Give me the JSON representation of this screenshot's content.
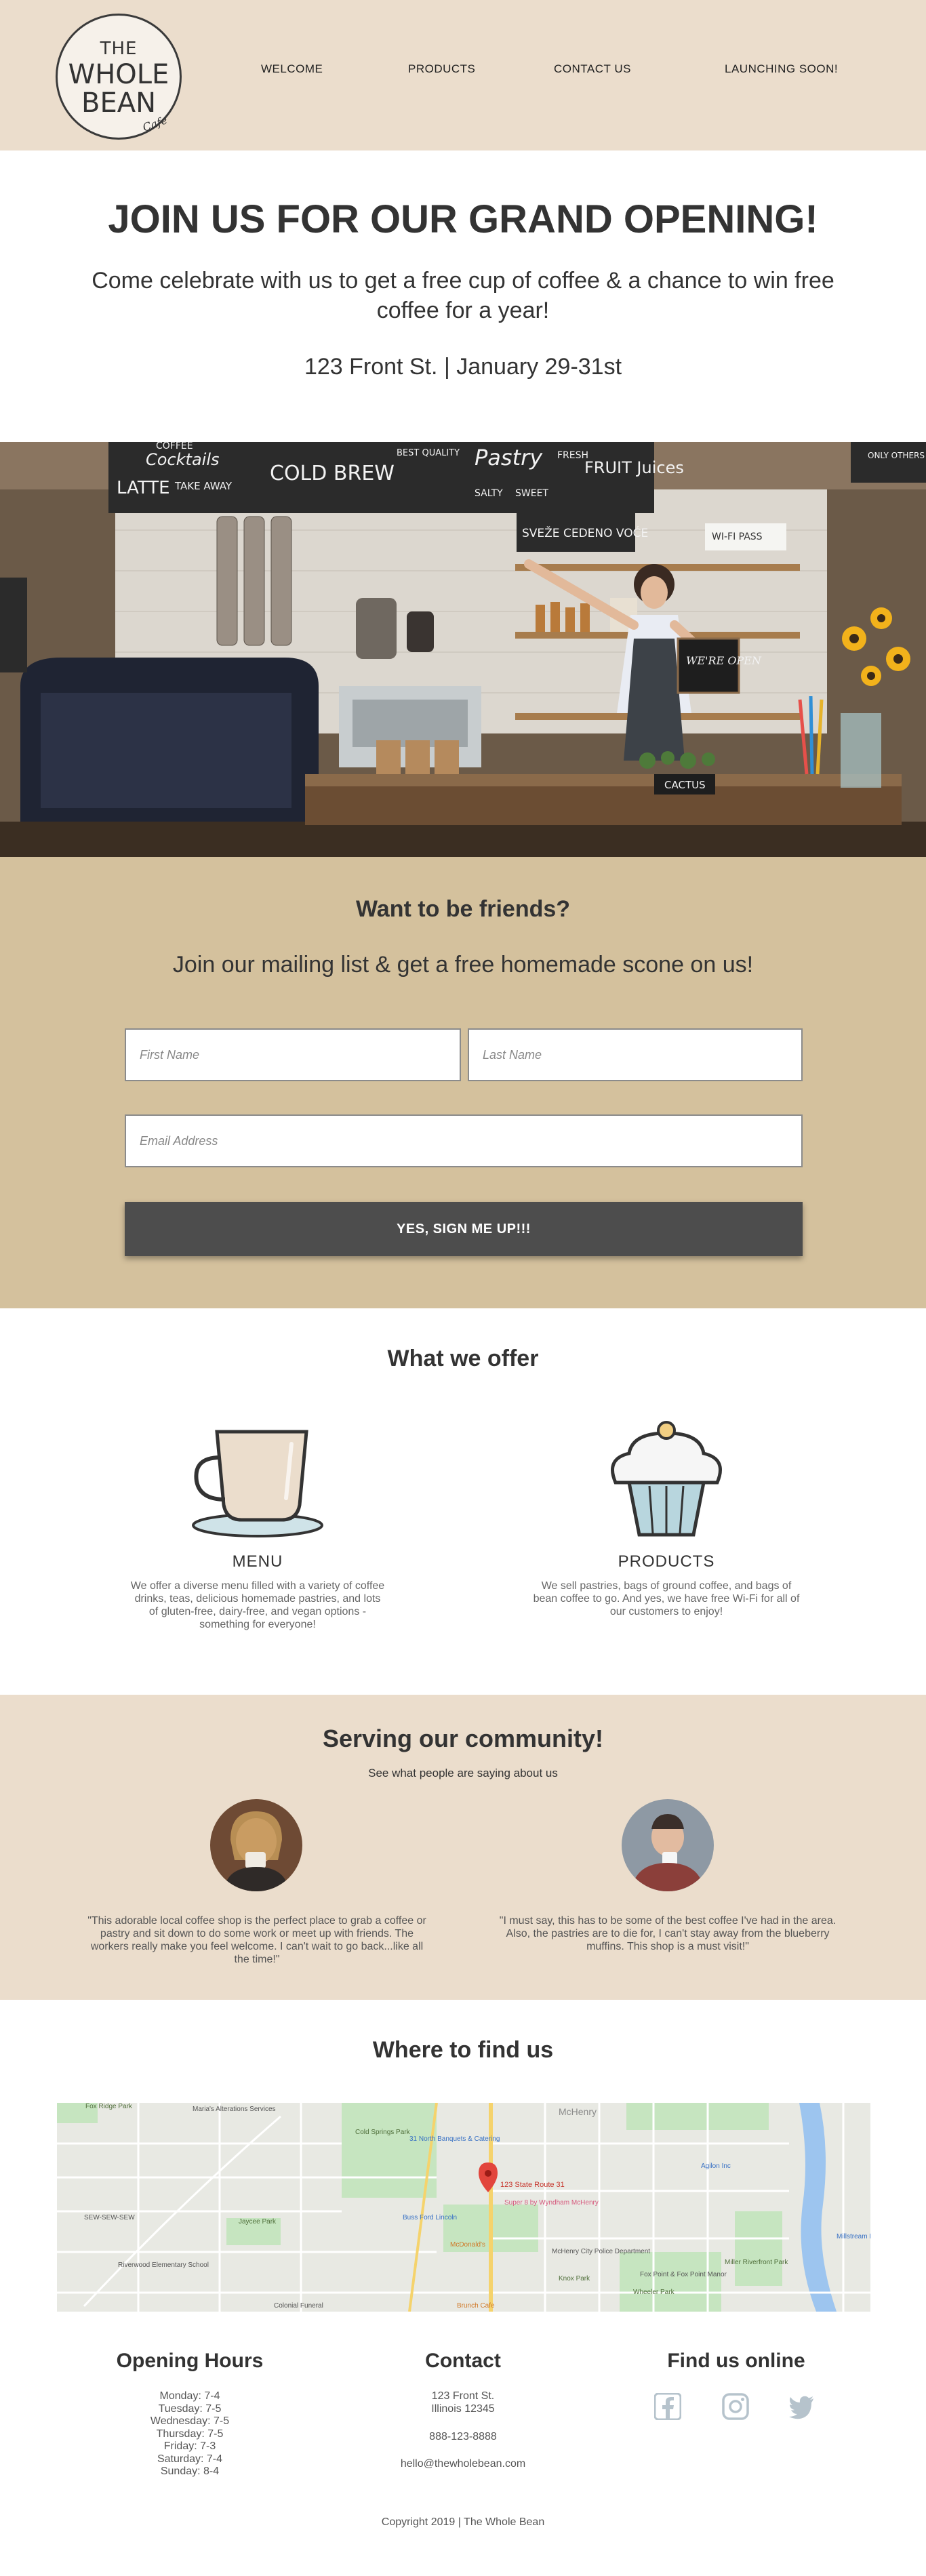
{
  "logo": {
    "line1": "THE",
    "line2": "WHOLE",
    "line3": "BEAN",
    "line4": "Cafe"
  },
  "nav": [
    "WELCOME",
    "PRODUCTS",
    "CONTACT US",
    "LAUNCHING SOON!"
  ],
  "hero": {
    "title": "JOIN US FOR OUR GRAND OPENING!",
    "subtitle": "Come celebrate with us to get a free cup of coffee & a chance to win free coffee for a year!",
    "address": "123 Front St. | January 29-31st"
  },
  "photo": {
    "signs": [
      "COFFEE",
      "Cocktails",
      "LATTE",
      "TAKE AWAY",
      "COLD BREW",
      "BEST QUALITY",
      "Pastry",
      "SALTY",
      "SWEET",
      "FRESH",
      "FRUIT Juices",
      "SVEŽE CEDENO VOĆE",
      "WI-FI PASS",
      "WE'RE OPEN",
      "CACTUS",
      "ONLY OTHERS ROAST"
    ]
  },
  "signup": {
    "title": "Want to be friends?",
    "subtitle": "Join our mailing list & get a free homemade scone on us!",
    "first_name_placeholder": "First Name",
    "last_name_placeholder": "Last Name",
    "email_placeholder": "Email Address",
    "button_label": "YES, SIGN ME UP!!!"
  },
  "offer": {
    "title": "What we offer",
    "items": [
      {
        "label": "MENU",
        "text": "We offer a diverse menu filled with a variety of coffee drinks, teas, delicious homemade pastries, and lots of gluten-free, dairy-free, and vegan options - something for everyone!",
        "icon": "coffee-cup-icon"
      },
      {
        "label": "PRODUCTS",
        "text": "We sell pastries, bags of ground coffee, and bags of bean coffee to go. And yes, we have free Wi-Fi for all of our customers to enjoy!",
        "icon": "cupcake-icon"
      }
    ]
  },
  "community": {
    "title": "Serving our community!",
    "subtitle": "See what people are saying about us",
    "testimonials": [
      "\"This adorable local coffee shop is the perfect place to grab a coffee or pastry and sit down to do some work or meet up with friends. The workers really make you feel welcome. I can't wait to go back...like all the time!\"",
      "\"I must say, this has to be some of the best coffee I've had in the area. Also, the pastries are to die for, I can't stay away from the blueberry muffins. This shop is a must visit!\""
    ]
  },
  "map": {
    "title": "Where to find us",
    "pin_label": "123 State Route 31",
    "labels": [
      "Fox Ridge Park",
      "Maria's Alterations Services",
      "Cold Springs Park",
      "31 North Banquets & Catering",
      "McHenry",
      "Agilon Inc",
      "Super 8 by Wyndham McHenry",
      "Buss Ford Lincoln",
      "McDonald's",
      "Jaycee Park",
      "SEW-SEW-SEW",
      "Riverwood Elementary School",
      "Knox Park",
      "McHenry City Police Department",
      "Fox Point & Fox Point Manor",
      "Miller Riverfront Park",
      "Wheeler Park",
      "Brunch Cafe",
      "Colonial Funeral",
      "Millstream Marina"
    ]
  },
  "footer": {
    "hours_title": "Opening Hours",
    "hours": [
      "Monday: 7-4",
      "Tuesday: 7-5",
      "Wednesday: 7-5",
      "Thursday: 7-5",
      "Friday: 7-3",
      "Saturday: 7-4",
      "Sunday: 8-4"
    ],
    "contact_title": "Contact",
    "address_line1": "123 Front St.",
    "address_line2": "Illinois 12345",
    "phone": "888-123-8888",
    "email": "hello@thewholebean.com",
    "social_title": "Find us online",
    "social_icons": [
      "facebook-icon",
      "instagram-icon",
      "twitter-icon"
    ],
    "copyright": "Copyright 2019 | The Whole Bean"
  },
  "colors": {
    "header_bg": "#ebddcc",
    "signup_bg": "#d4c19d",
    "button_bg": "#4d4d4d",
    "social_icon": "#b6c3cc"
  }
}
